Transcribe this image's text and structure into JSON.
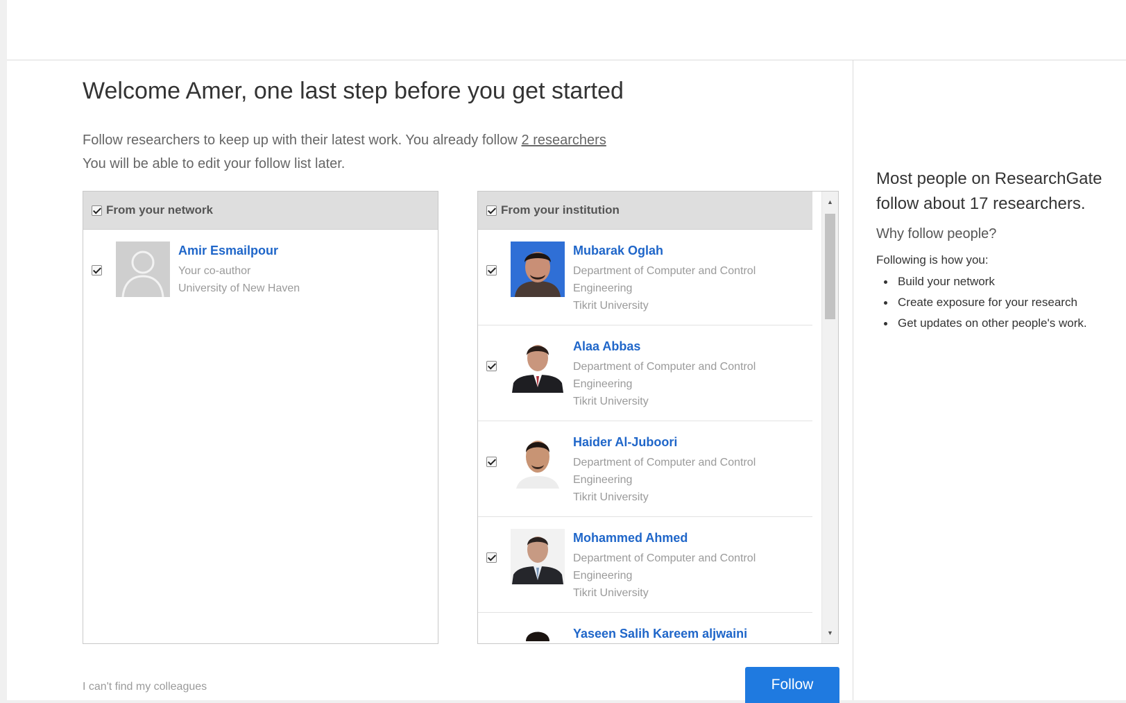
{
  "header": {
    "title": "Welcome Amer, one last step before you get started",
    "intro_line1": "Follow researchers to keep up with their latest work. You already follow ",
    "intro_link": "2 researchers",
    "intro_line2": "You will be able to edit your follow list later."
  },
  "network_panel": {
    "header_label": "From your network",
    "header_checked": true,
    "people": [
      {
        "name": "Amir Esmailpour",
        "line1": "Your co-author",
        "line2": "University of New Haven",
        "checked": true,
        "avatar": "default-avatar-icon"
      }
    ]
  },
  "institution_panel": {
    "header_label": "From your institution",
    "header_checked": true,
    "people": [
      {
        "name": "Mubarak Oglah",
        "line1": "Department of Computer and Control",
        "line2": "Engineering",
        "line3": "Tikrit University",
        "checked": true
      },
      {
        "name": "Alaa Abbas",
        "line1": "Department of Computer and Control",
        "line2": "Engineering",
        "line3": "Tikrit University",
        "checked": true
      },
      {
        "name": "Haider Al-Juboori",
        "line1": "Department of Computer and Control",
        "line2": "Engineering",
        "line3": "Tikrit University",
        "checked": true
      },
      {
        "name": "Mohammed Ahmed",
        "line1": "Department of Computer and Control",
        "line2": "Engineering",
        "line3": "Tikrit University",
        "checked": true
      },
      {
        "name": "Yaseen Salih Kareem aljwaini"
      }
    ]
  },
  "sidebar": {
    "headline": "Most people on ResearchGate follow about 17 researchers.",
    "why": "Why follow people?",
    "following_intro": "Following is how you:",
    "bullets": [
      "Build your network",
      "Create exposure for your research",
      "Get updates on other people's work."
    ]
  },
  "footer": {
    "cant_find": "I can't find my colleagues",
    "follow_button": "Follow"
  },
  "colors": {
    "link_blue": "#1f66c9",
    "button_blue": "#1f7ae0",
    "panel_header_bg": "#dedede"
  }
}
